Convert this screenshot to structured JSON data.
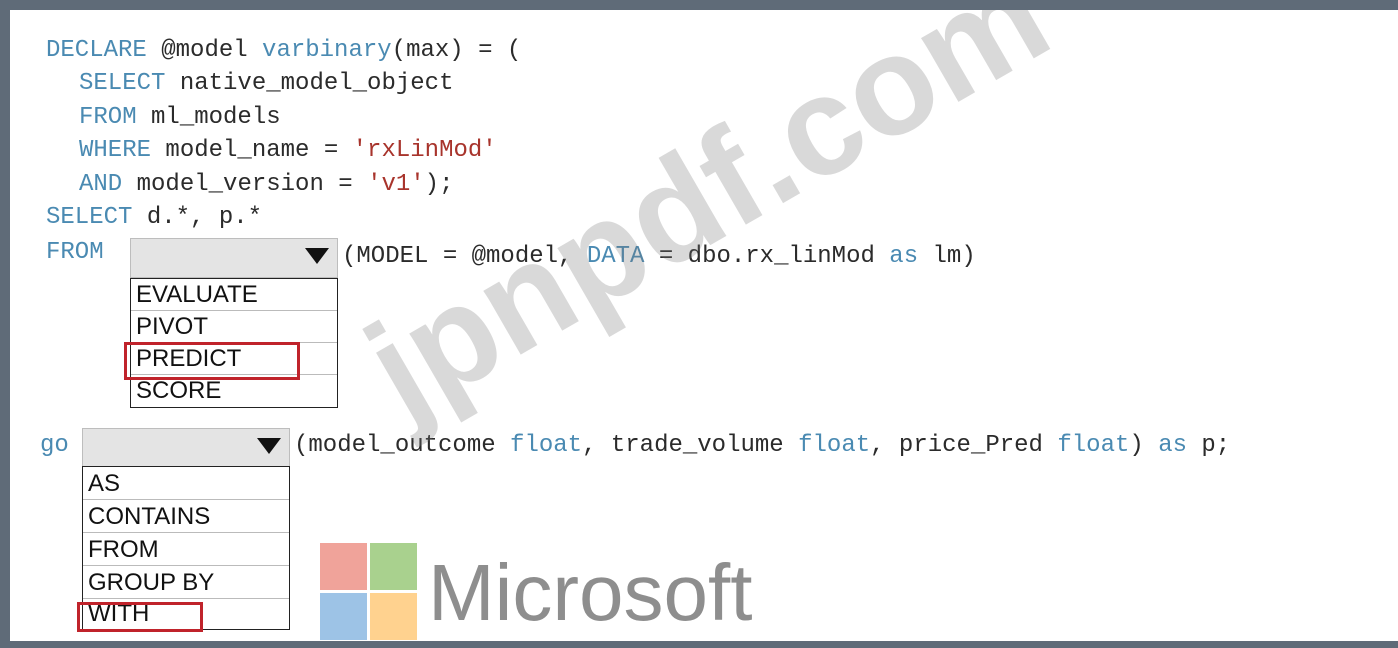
{
  "code": {
    "line1": {
      "kw1": "DECLARE",
      "t1": " @model ",
      "kw2": "varbinary",
      "t2": "(max) = ("
    },
    "line2": {
      "kw": "SELECT",
      "t": " native_model_object"
    },
    "line3": {
      "kw": "FROM",
      "t": " ml_models"
    },
    "line4": {
      "kw": "WHERE",
      "t": " model_name = ",
      "str": "'rxLinMod'"
    },
    "line5": {
      "kw": "AND",
      "t": " model_version = ",
      "str": "'v1'",
      "t2": ");"
    },
    "line6": {
      "kw": "SELECT",
      "t": " d.*, p.*"
    },
    "line7": {
      "kw": "FROM"
    },
    "line7_rest": {
      "t1": "(MODEL = @model, ",
      "kw1": "DATA",
      "t2": " = dbo.rx_linMod ",
      "kw2": "as",
      "t3": " lm)"
    },
    "line8": {
      "kw": "go"
    },
    "line8_rest": {
      "t1": "(model_outcome ",
      "kw1": "float",
      "t2": ", trade_volume ",
      "kw2": "float",
      "t3": ", price_Pred ",
      "kw3": "float",
      "t4": ") ",
      "kw4": "as",
      "t5": " p;"
    }
  },
  "dropdown1": {
    "options": [
      "EVALUATE",
      "PIVOT",
      "PREDICT",
      "SCORE"
    ],
    "selected": "PREDICT"
  },
  "dropdown2": {
    "options": [
      "AS",
      "CONTAINS",
      "FROM",
      "GROUP BY",
      "WITH"
    ],
    "selected": "WITH"
  },
  "watermark": "jpnpdf.com",
  "brand": {
    "name": "Microsoft",
    "colors": [
      "#f0a39a",
      "#a9d18e",
      "#9dc3e6",
      "#ffd28f"
    ]
  }
}
